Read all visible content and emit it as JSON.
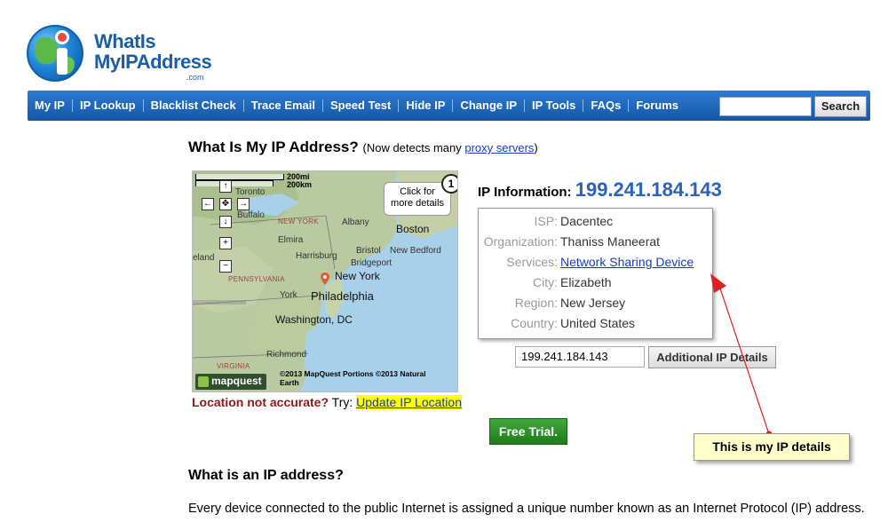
{
  "logo": {
    "line1": "WhatIs",
    "line2": "MyIPAddress",
    "suffix": ".com"
  },
  "nav": {
    "items": [
      "My IP",
      "IP Lookup",
      "Blacklist Check",
      "Trace Email",
      "Speed Test",
      "Hide IP",
      "Change IP",
      "IP Tools",
      "FAQs",
      "Forums"
    ],
    "search_value": "",
    "search_button": "Search"
  },
  "heading": {
    "title": "What Is My IP Address?",
    "sub_prefix": "(Now detects many ",
    "sub_link": "proxy servers",
    "sub_suffix": ")"
  },
  "map": {
    "scale_mi": "200mi",
    "scale_km": "200km",
    "tooltip_line1": "Click for",
    "tooltip_line2": "more details",
    "badge": "1",
    "labels": {
      "toronto": "Toronto",
      "buffalo": "Buffalo",
      "new_york_state": "NEW YORK",
      "albany": "Albany",
      "boston": "Boston",
      "elmira": "Elmira",
      "bristol": "Bristol",
      "new_bedford": "New Bedford",
      "harrisburg": "Harrisburg",
      "bridgeport": "Bridgeport",
      "eland": "eland",
      "pennsylvania": "PENNSYLVANIA",
      "new_york": "New York",
      "york": "York",
      "philadelphia": "Philadelphia",
      "washington": "Washington, DC",
      "richmond": "Richmond",
      "virginia": "VIRGINIA"
    },
    "copyright_line1": "©2013 MapQuest  Portions ©2013 Natural",
    "copyright_line2": "Earth",
    "brand": "mapquest"
  },
  "location": {
    "warning": "Location not accurate?",
    "try": " Try: ",
    "link": "Update IP Location"
  },
  "ip_info": {
    "label": "IP Information: ",
    "ip": "199.241.184.143",
    "rows": [
      {
        "k": "ISP:",
        "v": "Dacentec"
      },
      {
        "k": "Organization:",
        "v": "Thaniss Maneerat"
      },
      {
        "k": "Services:",
        "v": "Network Sharing Device"
      },
      {
        "k": "City:",
        "v": "Elizabeth"
      },
      {
        "k": "Region:",
        "v": "New Jersey"
      },
      {
        "k": "Country:",
        "v": "United States"
      }
    ],
    "input_value": "199.241.184.143",
    "details_button": "Additional IP Details"
  },
  "trial_button": "Free Trial.",
  "annotation": "This is my IP details",
  "section": {
    "heading": "What is an IP address?",
    "body": "Every device connected to the public Internet is assigned a unique number known as an Internet Protocol (IP) address."
  },
  "colors": {
    "nav": "#1f6bc0",
    "ip_accent": "#2a63b8",
    "link": "#1a3bbd",
    "warning": "#8b1a1a",
    "trial": "#2e9428",
    "annotation_bg": "#ffffcc"
  }
}
